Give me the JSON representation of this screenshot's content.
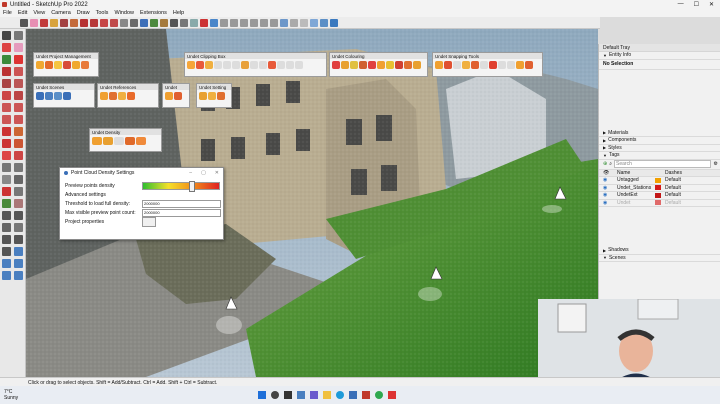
{
  "window": {
    "title": "Untitled - SketchUp Pro 2022",
    "controls": [
      "—",
      "☐",
      "✕"
    ]
  },
  "menu": [
    "File",
    "Edit",
    "View",
    "Camera",
    "Draw",
    "Tools",
    "Window",
    "Extensions",
    "Help"
  ],
  "toolbars": {
    "project_management": "Undet Project Management",
    "clipping_box": "Undet Clipping Box",
    "colouring": "Undet Colouring",
    "snapping_tools": "Undet Snapping Tools",
    "scenes": "Undet Scenes",
    "references": "Undet References",
    "undet_small": "Undet",
    "settings": "Undet Setting",
    "density": "Undet Density"
  },
  "dialog": {
    "title": "Point Cloud Density Settings",
    "preview_density_label": "Preview points density",
    "preview_density_value": 0.6,
    "advanced_label": "Advanced settings",
    "threshold_label": "Threshold to load full density:",
    "threshold_value": "2000000",
    "max_visible_label": "Max visible preview point count:",
    "max_visible_value": "2000000",
    "project_props_label": "Project properties"
  },
  "tray": {
    "title": "Default Tray",
    "entity_info": "Entity Info",
    "no_selection": "No Selection",
    "materials": "Materials",
    "components": "Components",
    "styles": "Styles",
    "tags": "Tags",
    "search_placeholder": "Search",
    "col_name": "Name",
    "col_dashes": "Dashes",
    "tags_rows": [
      {
        "name": "Untagged",
        "dashes": "Default",
        "color": "#f2a000"
      },
      {
        "name": "Undet_Stations",
        "dashes": "Default",
        "color": "#d31a1a"
      },
      {
        "name": "UndetExt",
        "dashes": "Default",
        "color": "#c21616"
      },
      {
        "name": "Undet",
        "dashes": "Default",
        "color": "#e06a6a"
      }
    ],
    "shadows": "Shadows",
    "scenes": "Scenes"
  },
  "status": {
    "hint": "Click or drag to select objects. Shift = Add/Subtract. Ctrl = Add. Shift + Ctrl = Subtract."
  },
  "taskbar": {
    "weather_temp": "7°C",
    "weather_desc": "Sunny"
  },
  "colors": {
    "accent": "#1e6fd9",
    "grass": "#3f8a2a",
    "building": "#b0a48a"
  }
}
